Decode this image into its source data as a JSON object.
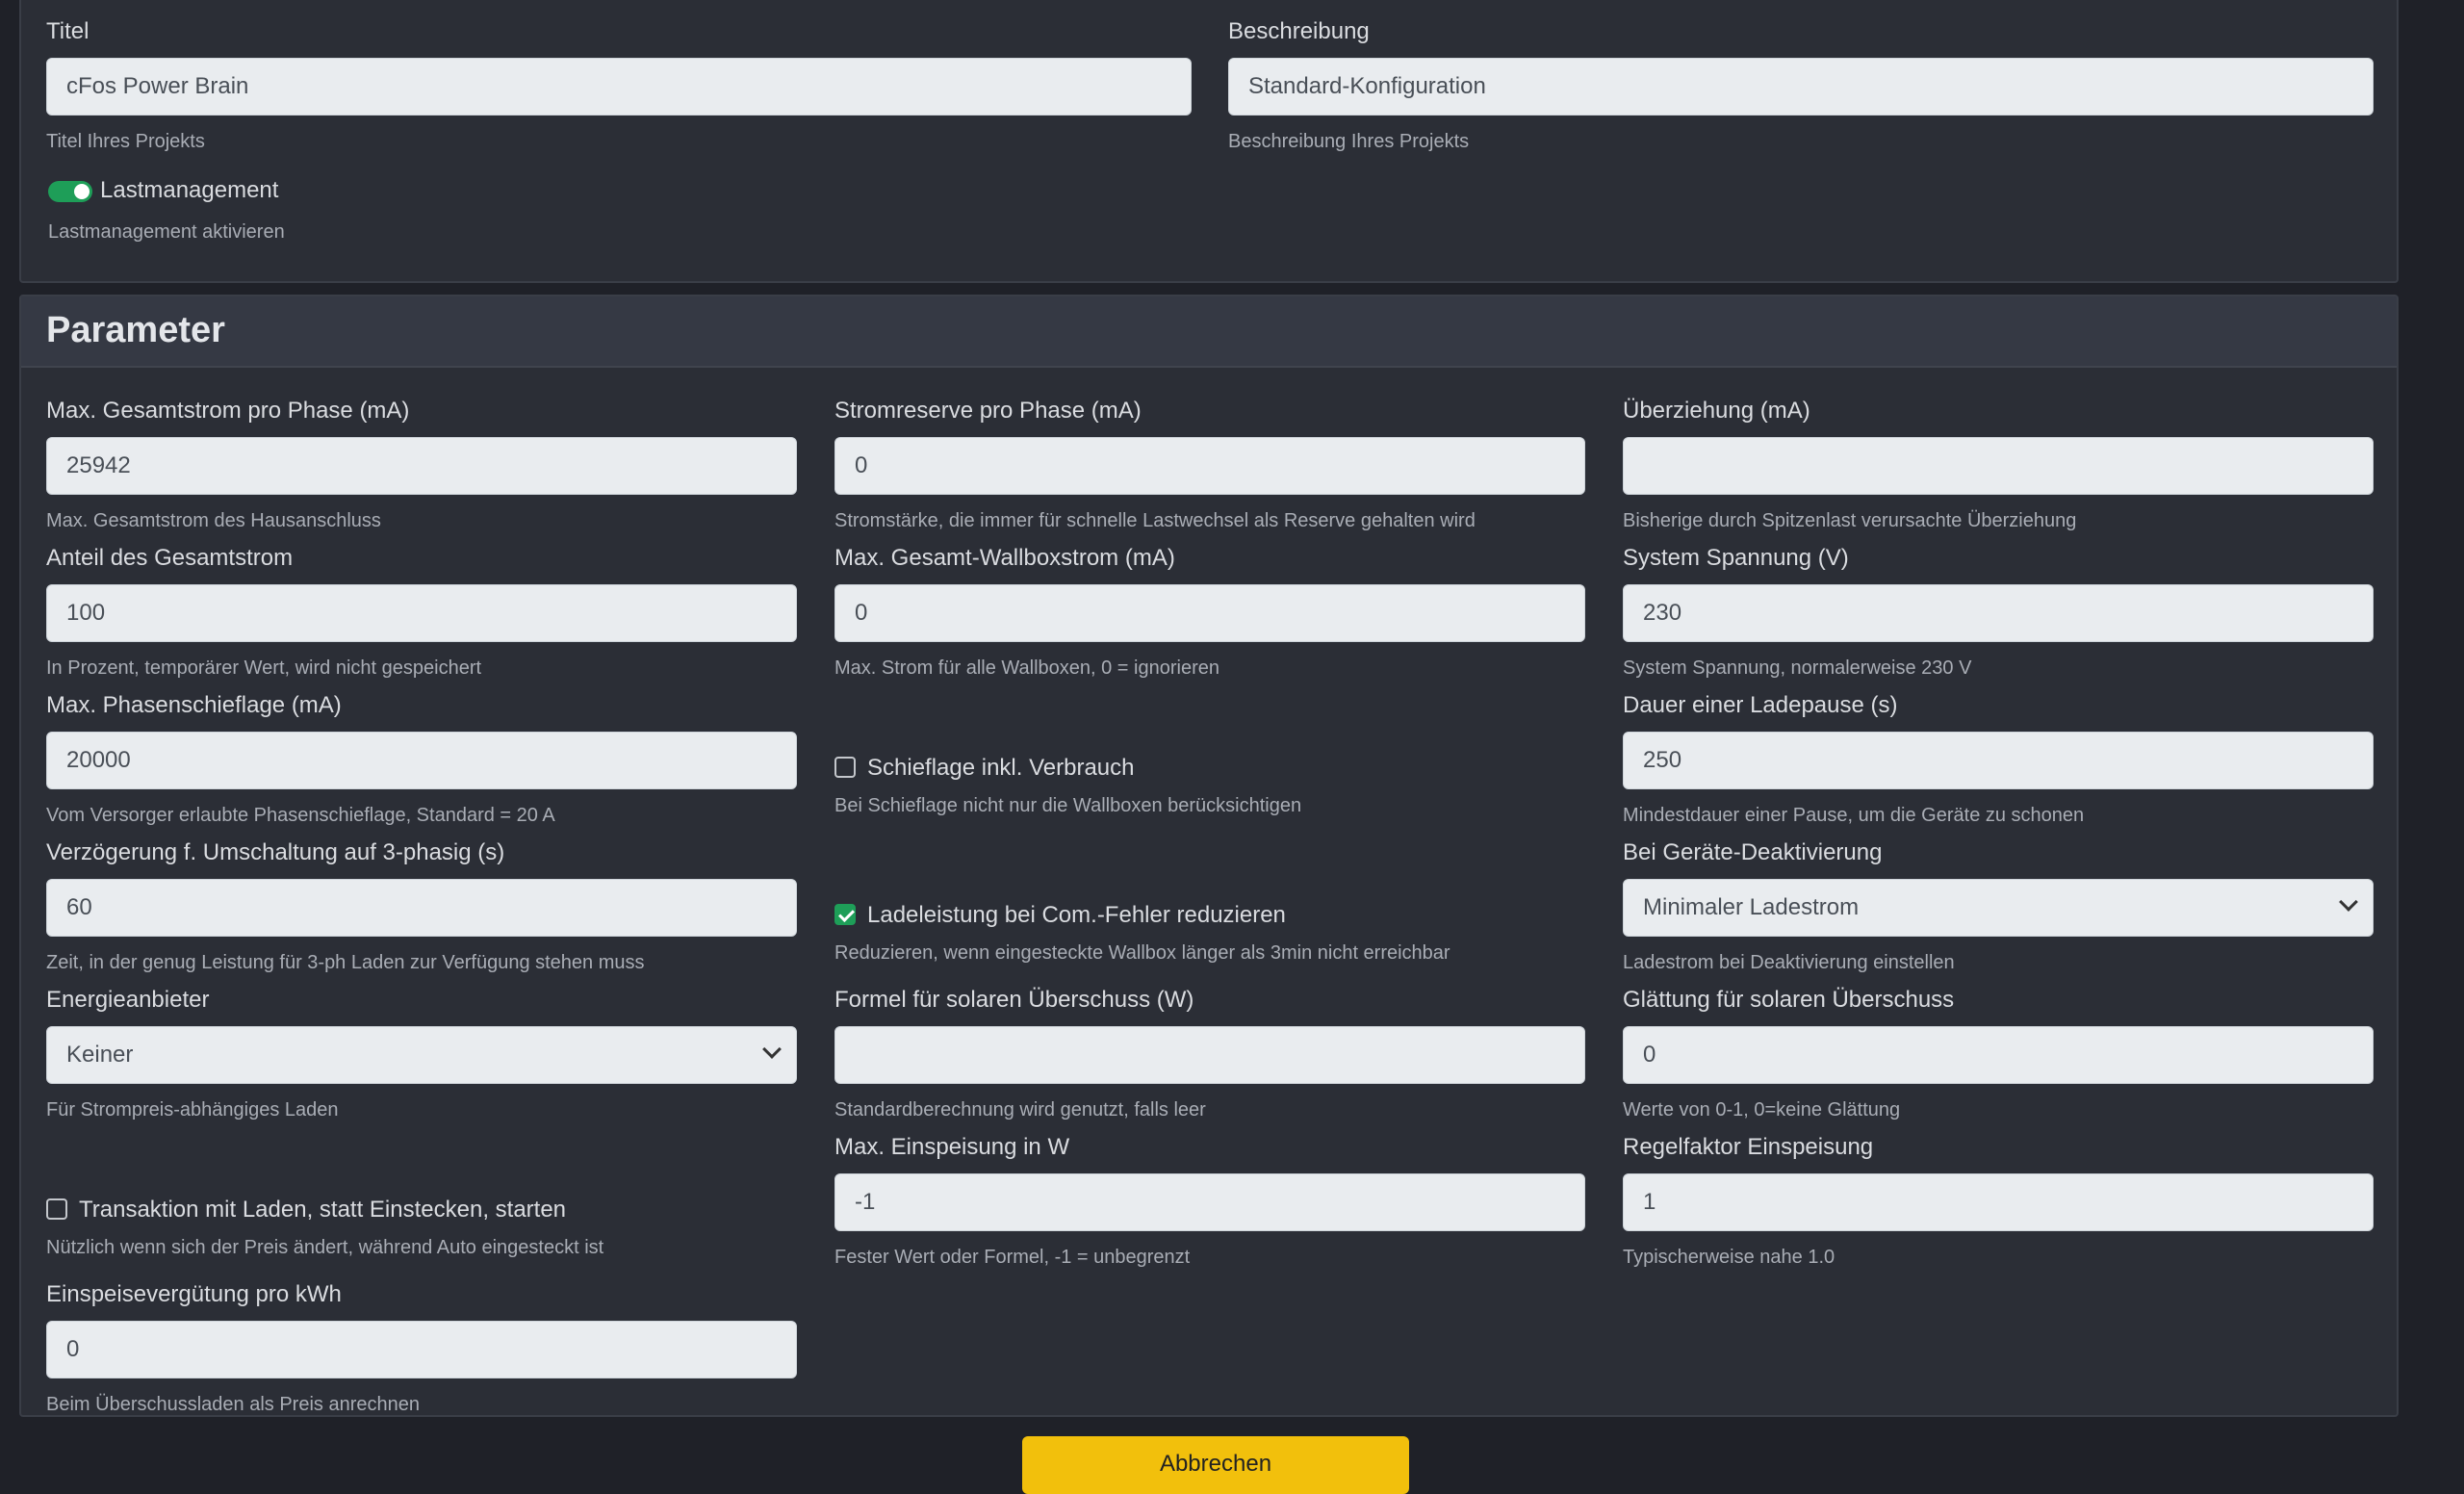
{
  "project": {
    "title_label": "Titel",
    "title_value": "cFos Power Brain",
    "title_hint": "Titel Ihres Projekts",
    "desc_label": "Beschreibung",
    "desc_value": "Standard-Konfiguration",
    "desc_hint": "Beschreibung Ihres Projekts",
    "lm_label": "Lastmanagement",
    "lm_hint": "Lastmanagement aktivieren",
    "lm_enabled": true
  },
  "parameter": {
    "heading": "Parameter",
    "max_total": {
      "label": "Max. Gesamtstrom pro Phase (mA)",
      "value": "25942",
      "hint": "Max. Gesamtstrom des Hausanschluss"
    },
    "reserve": {
      "label": "Stromreserve pro Phase (mA)",
      "value": "0",
      "hint": "Stromstärke, die immer für schnelle Lastwechsel als Reserve gehalten wird"
    },
    "overdraw": {
      "label": "Überziehung (mA)",
      "value": "",
      "hint": "Bisherige durch Spitzenlast verursachte Überziehung"
    },
    "share": {
      "label": "Anteil des Gesamtstrom",
      "value": "100",
      "hint": "In Prozent, temporärer Wert, wird nicht gespeichert"
    },
    "max_wallbox": {
      "label": "Max. Gesamt-Wallboxstrom (mA)",
      "value": "0",
      "hint": "Max. Strom für alle Wallboxen, 0 = ignorieren"
    },
    "voltage": {
      "label": "System Spannung (V)",
      "value": "230",
      "hint": "System Spannung, normalerweise 230 V"
    },
    "imbalance": {
      "label": "Max. Phasenschieflage (mA)",
      "value": "20000",
      "hint": "Vom Versorger erlaubte Phasenschieflage, Standard = 20 A"
    },
    "imbalance_incl": {
      "label": "Schieflage inkl. Verbrauch",
      "hint": "Bei Schieflage nicht nur die Wallboxen berücksichtigen",
      "checked": false
    },
    "pause": {
      "label": "Dauer einer Ladepause (s)",
      "value": "250",
      "hint": "Mindestdauer einer Pause, um die Geräte zu schonen"
    },
    "delay3ph": {
      "label": "Verzögerung f. Umschaltung auf 3-phasig (s)",
      "value": "60",
      "hint": "Zeit, in der genug Leistung für 3-ph Laden zur Verfügung stehen muss"
    },
    "comerr": {
      "label": "Ladeleistung bei Com.-Fehler reduzieren",
      "hint": "Reduzieren, wenn eingesteckte Wallbox länger als 3min nicht erreichbar",
      "checked": true
    },
    "deactivation": {
      "label": "Bei Geräte-Deaktivierung",
      "value": "Minimaler Ladestrom",
      "hint": "Ladestrom bei Deaktivierung einstellen"
    },
    "provider": {
      "label": "Energieanbieter",
      "value": "Keiner",
      "hint": "Für Strompreis-abhängiges Laden"
    },
    "solar_formula": {
      "label": "Formel für solaren Überschuss (W)",
      "value": "",
      "hint": "Standardberechnung wird genutzt, falls leer"
    },
    "smoothing": {
      "label": "Glättung für solaren Überschuss",
      "value": "0",
      "hint": "Werte von 0-1, 0=keine Glättung"
    },
    "transaction": {
      "label": "Transaktion mit Laden, statt Einstecken, starten",
      "hint": "Nützlich wenn sich der Preis ändert, während Auto eingesteckt ist",
      "checked": false
    },
    "max_feed": {
      "label": "Max. Einspeisung in W",
      "value": "-1",
      "hint": "Fester Wert oder Formel, -1 = unbegrenzt"
    },
    "feed_factor": {
      "label": "Regelfaktor Einspeisung",
      "value": "1",
      "hint": "Typischerweise nahe 1.0"
    },
    "feed_tariff": {
      "label": "Einspeisevergütung pro kWh",
      "value": "0",
      "hint": "Beim Überschussladen als Preis anrechnen"
    }
  },
  "cancel_label": "Abbrechen"
}
